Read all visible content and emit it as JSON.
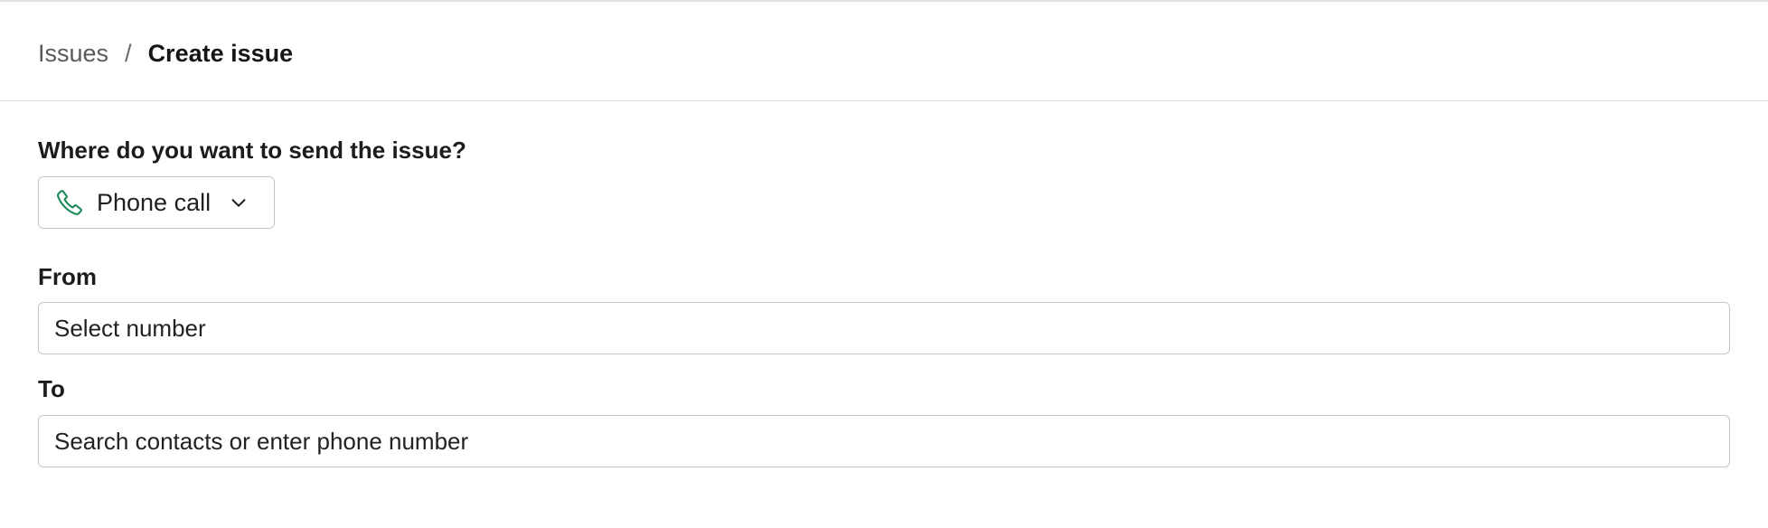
{
  "breadcrumb": {
    "parent": "Issues",
    "separator": "/",
    "current": "Create issue"
  },
  "form": {
    "channel": {
      "label": "Where do you want to send the issue?",
      "selected": "Phone call",
      "icon": "phone-icon",
      "icon_color": "#1f8a5b"
    },
    "from": {
      "label": "From",
      "placeholder": "Select number"
    },
    "to": {
      "label": "To",
      "placeholder": "Search contacts or enter phone number"
    }
  }
}
